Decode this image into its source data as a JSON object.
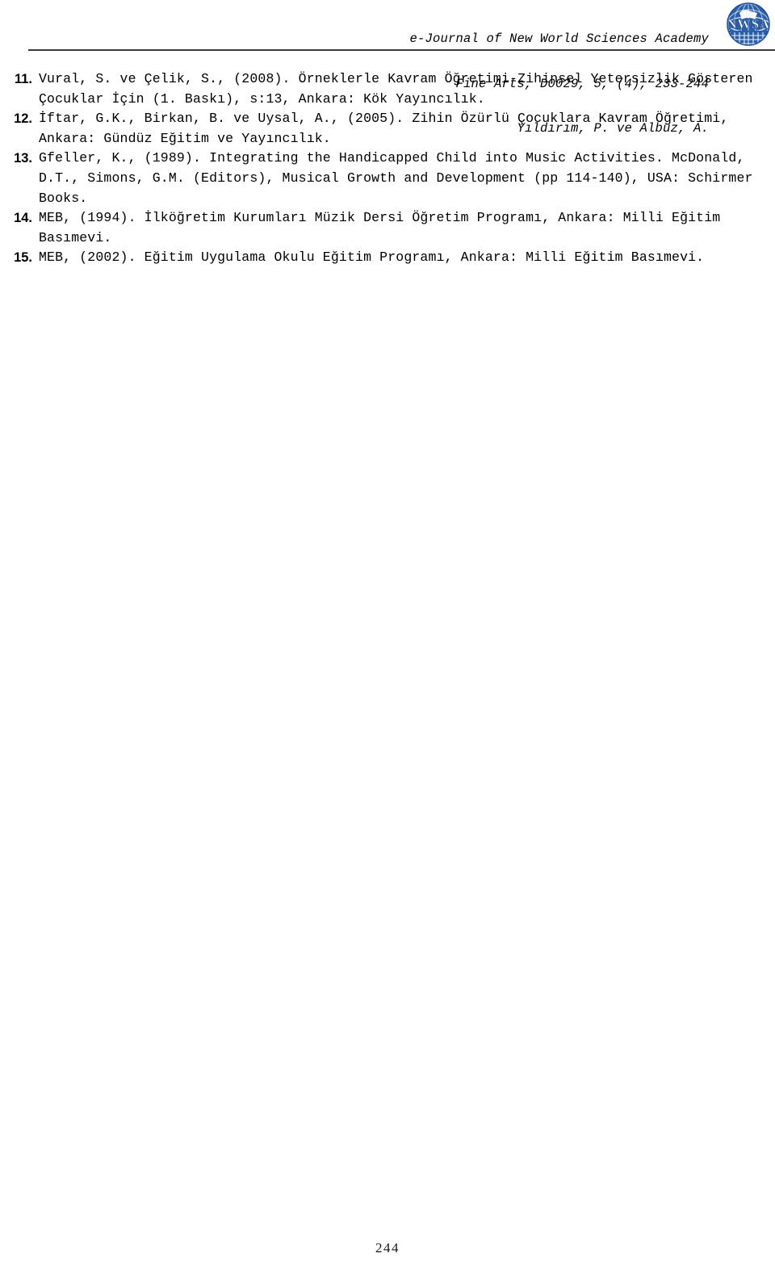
{
  "header": {
    "lines": [
      "e-Journal of New World Sciences Academy",
      "Fine Arts, D0029, 5, (4), 233-244",
      "Yıldırım, P. ve Albuz, A."
    ],
    "logo_alt": "NWSA",
    "logo_wordmark": "NWSA",
    "logo_color": "#1f4e9c"
  },
  "references": [
    {
      "number": "11.",
      "text": "Vural, S. ve Çelik, S., (2008). Örneklerle Kavram Öğretimi-Zihinsel Yetersizlik Gösteren Çocuklar İçin (1. Baskı), s:13, Ankara: Kök Yayıncılık."
    },
    {
      "number": "12.",
      "text": "İftar, G.K., Birkan, B. ve Uysal, A., (2005). Zihin Özürlü Çocuklara Kavram Öğretimi, Ankara: Gündüz Eğitim ve Yayıncılık."
    },
    {
      "number": "13.",
      "text": "Gfeller, K., (1989). Integrating the Handicapped Child into Music Activities. McDonald, D.T., Simons, G.M. (Editors), Musical Growth and Development (pp 114-140), USA: Schirmer  Books."
    },
    {
      "number": "14.",
      "text": "MEB, (1994). İlköğretim Kurumları Müzik Dersi Öğretim Programı, Ankara: Milli Eğitim Basımevi."
    },
    {
      "number": "15.",
      "text": "MEB, (2002). Eğitim Uygulama Okulu Eğitim Programı, Ankara: Milli Eğitim Basımevi."
    }
  ],
  "footer": {
    "page_number": "244"
  }
}
